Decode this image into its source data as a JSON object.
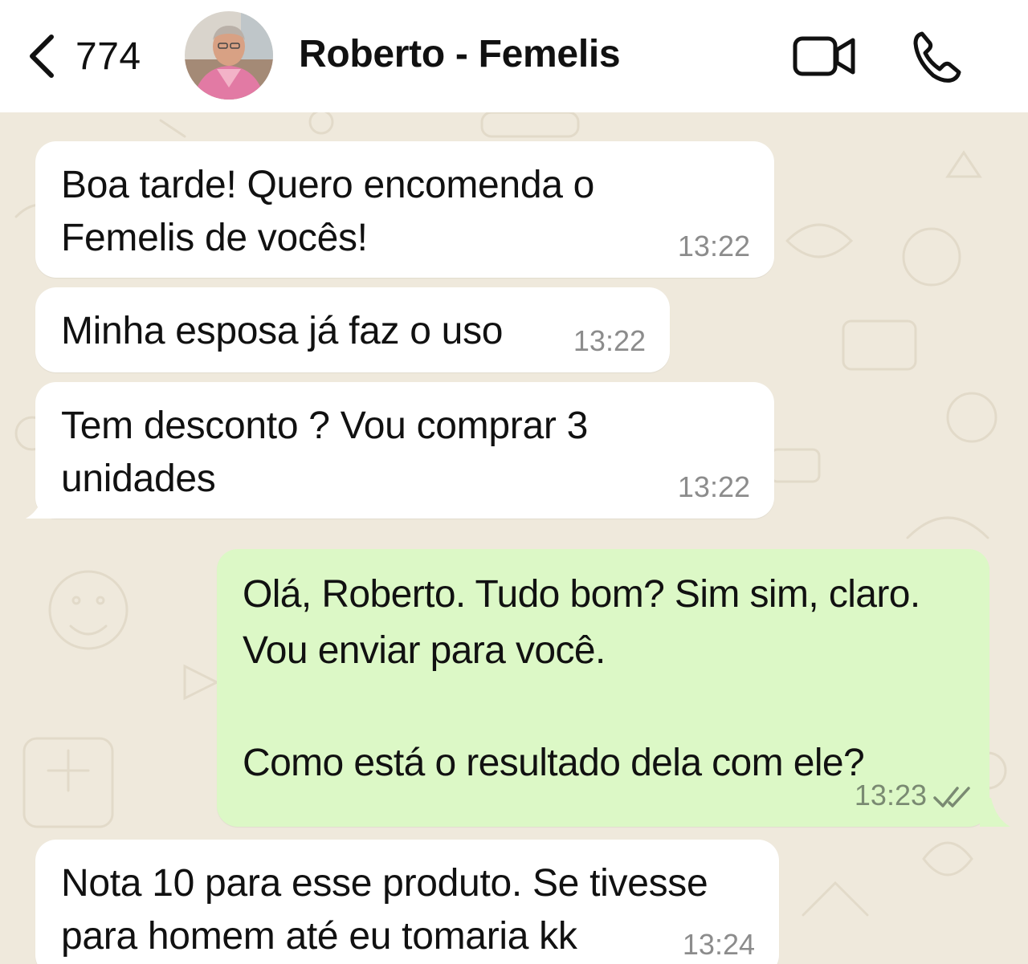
{
  "header": {
    "unread_count": "774",
    "contact_name": "Roberto - Femelis",
    "back_icon": "chevron-left-icon",
    "video_icon": "video-camera-icon",
    "call_icon": "phone-icon"
  },
  "messages": [
    {
      "direction": "incoming",
      "text": "Boa tarde! Quero encomenda o\nFemelis de vocês!",
      "time": "13:22"
    },
    {
      "direction": "incoming",
      "text": "Minha esposa já faz o uso",
      "time": "13:22"
    },
    {
      "direction": "incoming",
      "text": "Tem desconto ? Vou comprar 3\nunidades",
      "time": "13:22"
    },
    {
      "direction": "outgoing",
      "text": "Olá, Roberto. Tudo bom? Sim sim, claro.\nVou enviar para você.\n\nComo está o resultado dela com ele?",
      "time": "13:23",
      "status": "read"
    },
    {
      "direction": "incoming",
      "text": "Nota 10 para esse produto. Se tivesse\npara homem até eu tomaria kk",
      "time": "13:24"
    }
  ],
  "colors": {
    "incoming_bubble": "#ffffff",
    "outgoing_bubble": "#dcf8c6",
    "wallpaper": "#efe9dc",
    "timestamp": "#8c8c8c"
  }
}
